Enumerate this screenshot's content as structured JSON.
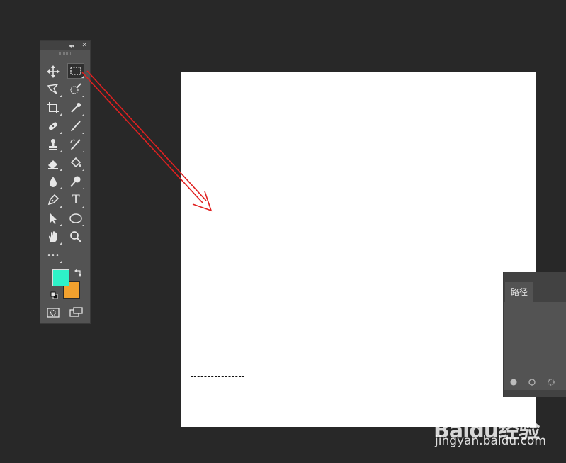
{
  "tools_panel": {
    "collapse_glyph": "◂◂",
    "close_glyph": "✕",
    "tools": [
      {
        "name": "move-icon",
        "active": false
      },
      {
        "name": "rectangular-marquee-icon",
        "active": true
      },
      {
        "name": "lasso-icon",
        "active": false
      },
      {
        "name": "quick-selection-icon",
        "active": false
      },
      {
        "name": "crop-icon",
        "active": false
      },
      {
        "name": "eyedropper-icon",
        "active": false
      },
      {
        "name": "healing-brush-icon",
        "active": false
      },
      {
        "name": "brush-icon",
        "active": false
      },
      {
        "name": "clone-stamp-icon",
        "active": false
      },
      {
        "name": "history-brush-icon",
        "active": false
      },
      {
        "name": "eraser-icon",
        "active": false
      },
      {
        "name": "paint-bucket-icon",
        "active": false
      },
      {
        "name": "blur-icon",
        "active": false
      },
      {
        "name": "dodge-icon",
        "active": false
      },
      {
        "name": "pen-icon",
        "active": false
      },
      {
        "name": "type-icon",
        "active": false,
        "glyph": "T"
      },
      {
        "name": "path-selection-icon",
        "active": false
      },
      {
        "name": "ellipse-icon",
        "active": false
      },
      {
        "name": "hand-icon",
        "active": false
      },
      {
        "name": "zoom-icon",
        "active": false
      },
      {
        "name": "more-tools-icon",
        "active": false,
        "glyph": "•••"
      }
    ],
    "foreground_color": "#2ef2c8",
    "background_color": "#f2a12e"
  },
  "canvas": {
    "background": "#ffffff"
  },
  "paths_panel": {
    "tab_label": "路径"
  },
  "annotation": {
    "arrow_color": "#e02020"
  },
  "watermark": {
    "logo_text": "Baidu经验",
    "url_text": "jingyan.baidu.com"
  }
}
